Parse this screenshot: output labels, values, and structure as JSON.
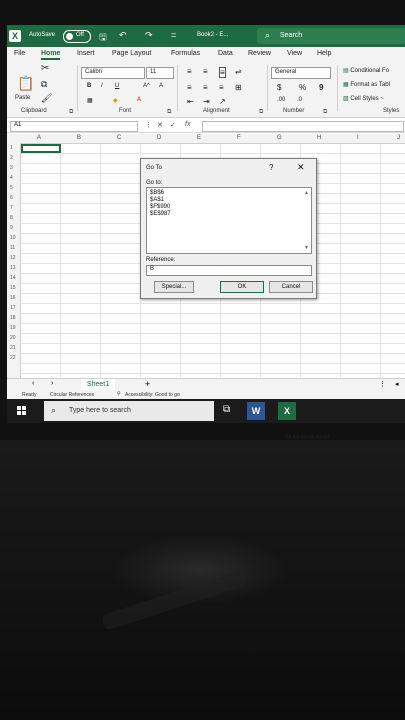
{
  "titlebar": {
    "autosave_label": "AutoSave",
    "toggle_state": "Off",
    "doc_title": "Book2 - E...",
    "search_placeholder": "Search"
  },
  "tabs": [
    "File",
    "Home",
    "Insert",
    "Page Layout",
    "Formulas",
    "Data",
    "Review",
    "View",
    "Help"
  ],
  "active_tab": "Home",
  "ribbon": {
    "paste_label": "Paste",
    "font_name": "Calibri",
    "font_size": "11",
    "number_format": "General",
    "groups": {
      "clipboard": "Clipboard",
      "font": "Font",
      "alignment": "Alignment",
      "number": "Number",
      "styles": "Styles"
    },
    "styles_items": [
      "Conditional Fo",
      "Format as Tabl",
      "Cell Styles ~"
    ],
    "bold": "B",
    "italic": "I",
    "underline": "U",
    "grow_font": "A^",
    "shrink_font": "A",
    "currency": "$",
    "percent": "%",
    "comma": "9"
  },
  "formula_bar": {
    "name_box": "A1",
    "fx": "fx"
  },
  "columns": [
    "A",
    "B",
    "C",
    "D",
    "E",
    "F",
    "G",
    "H",
    "I",
    "J"
  ],
  "rows": [
    "1",
    "2",
    "3",
    "4",
    "5",
    "6",
    "7",
    "8",
    "9",
    "10",
    "11",
    "12",
    "13",
    "14",
    "15",
    "16",
    "17",
    "18",
    "19",
    "20",
    "21",
    "22"
  ],
  "dialog": {
    "title": "Go To",
    "help": "?",
    "close": "✕",
    "goto_label": "Go to:",
    "items": [
      "$B$6",
      "$A$1",
      "$F$990",
      "$E$987"
    ],
    "reference_label": "Reference:",
    "reference_value": "B",
    "special_button": "Special...",
    "ok_button": "OK",
    "cancel_button": "Cancel"
  },
  "sheetbar": {
    "sheet_tab": "Sheet1",
    "add_sheet": "+"
  },
  "status": {
    "ready": "Ready",
    "circular": "Circular References",
    "accessibility": "Accessibility: Good to go"
  },
  "taskbar": {
    "search_placeholder": "Type here to search"
  },
  "colors": {
    "excel_green": "#1f6b41",
    "word_blue": "#2b579a"
  }
}
